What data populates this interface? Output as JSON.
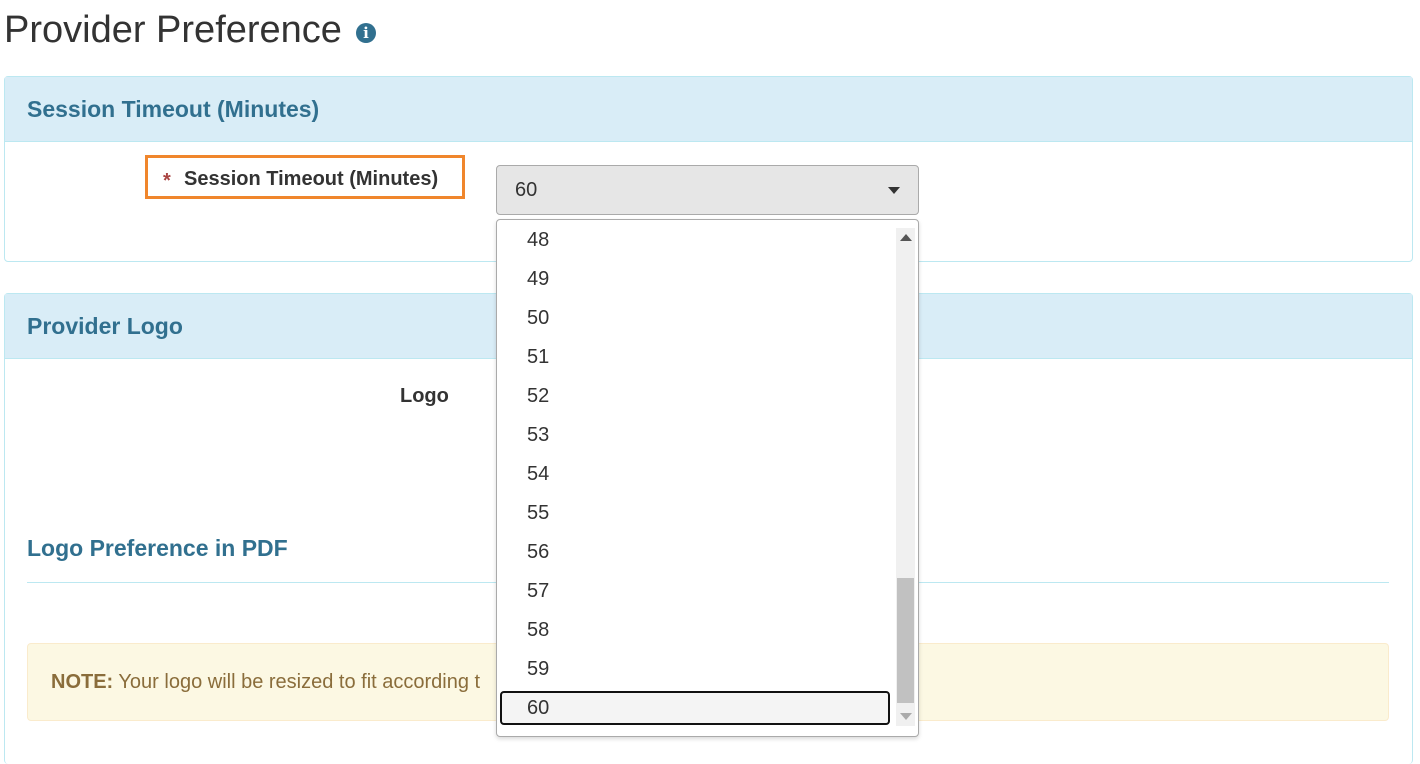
{
  "page": {
    "title": "Provider Preference",
    "info_icon": "info-circle-icon"
  },
  "session_panel": {
    "heading": "Session Timeout (Minutes)",
    "required_mark": "*",
    "field_label": "Session Timeout (Minutes)",
    "selected_value": "60",
    "options_visible": [
      "48",
      "49",
      "50",
      "51",
      "52",
      "53",
      "54",
      "55",
      "56",
      "57",
      "58",
      "59",
      "60"
    ]
  },
  "logo_panel": {
    "heading": "Provider Logo",
    "logo_label": "Logo",
    "pdf_heading": "Logo Preference in PDF",
    "note_label": "NOTE:",
    "note_text": "Your logo will be resized to fit according t"
  },
  "colors": {
    "panel_heading_bg": "#d9edf7",
    "panel_heading_text": "#31708f",
    "highlight_border": "#f0862c",
    "note_bg": "#fcf8e3"
  }
}
